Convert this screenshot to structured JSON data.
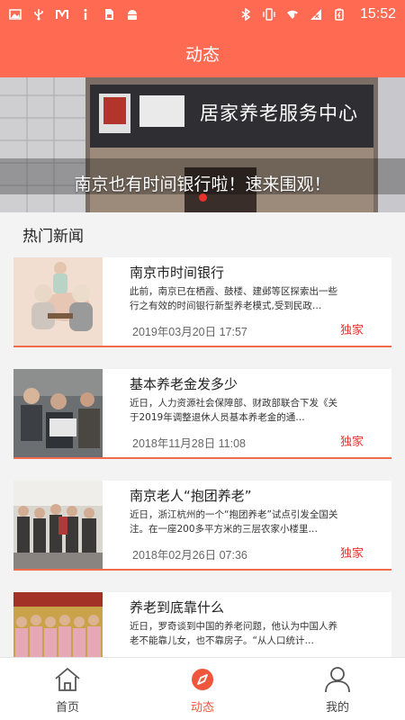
{
  "status_bar": {
    "time": "15:52",
    "left_icons": [
      "image-icon",
      "usb-icon",
      "app-m-icon",
      "info-icon",
      "sim-icon",
      "android-icon"
    ],
    "right_icons": [
      "bluetooth-icon",
      "vibrate-icon",
      "wifi-icon",
      "signal-icon",
      "battery-icon"
    ]
  },
  "header": {
    "title": "动态"
  },
  "banner": {
    "caption": "南京也有时间银行啦！速来围观！",
    "sign_text": "居家养老服务中心",
    "active_dot_color": "#e8322c"
  },
  "section": {
    "title": "热门新闻"
  },
  "news": [
    {
      "title": "南京市时间银行",
      "summary": "此前，南京已在栖霞、鼓楼、建邺等区探索出一些行之有效的时间银行新型养老模式,受到民政…",
      "date": "2019年03月20日 17:57",
      "tag": "独家"
    },
    {
      "title": "基本养老金发多少",
      "summary": "近日，人力资源社会保障部、财政部联合下发《关于2019年调整退休人员基本养老金的通…",
      "date": "2018年11月28日 11:08",
      "tag": "独家"
    },
    {
      "title": "南京老人“抱团养老”",
      "summary": "近日，浙江杭州的一个“抱团养老”试点引发全国关注。在一座200多平方米的三层农家小楼里…",
      "date": "2018年02月26日 07:36",
      "tag": "独家"
    },
    {
      "title": "养老到底靠什么",
      "summary": "近日，罗奇谈到中国的养老问题，他认为中国人养老不能靠儿女，也不靠房子。“从人口统计…",
      "date": "",
      "tag": ""
    }
  ],
  "tabs": [
    {
      "label": "首页",
      "icon": "home-icon"
    },
    {
      "label": "动态",
      "icon": "compass-icon",
      "active": true
    },
    {
      "label": "我的",
      "icon": "user-icon"
    }
  ],
  "colors": {
    "brand": "#ff6a52",
    "accent": "#e8322c",
    "tab_active": "#f0563c"
  }
}
